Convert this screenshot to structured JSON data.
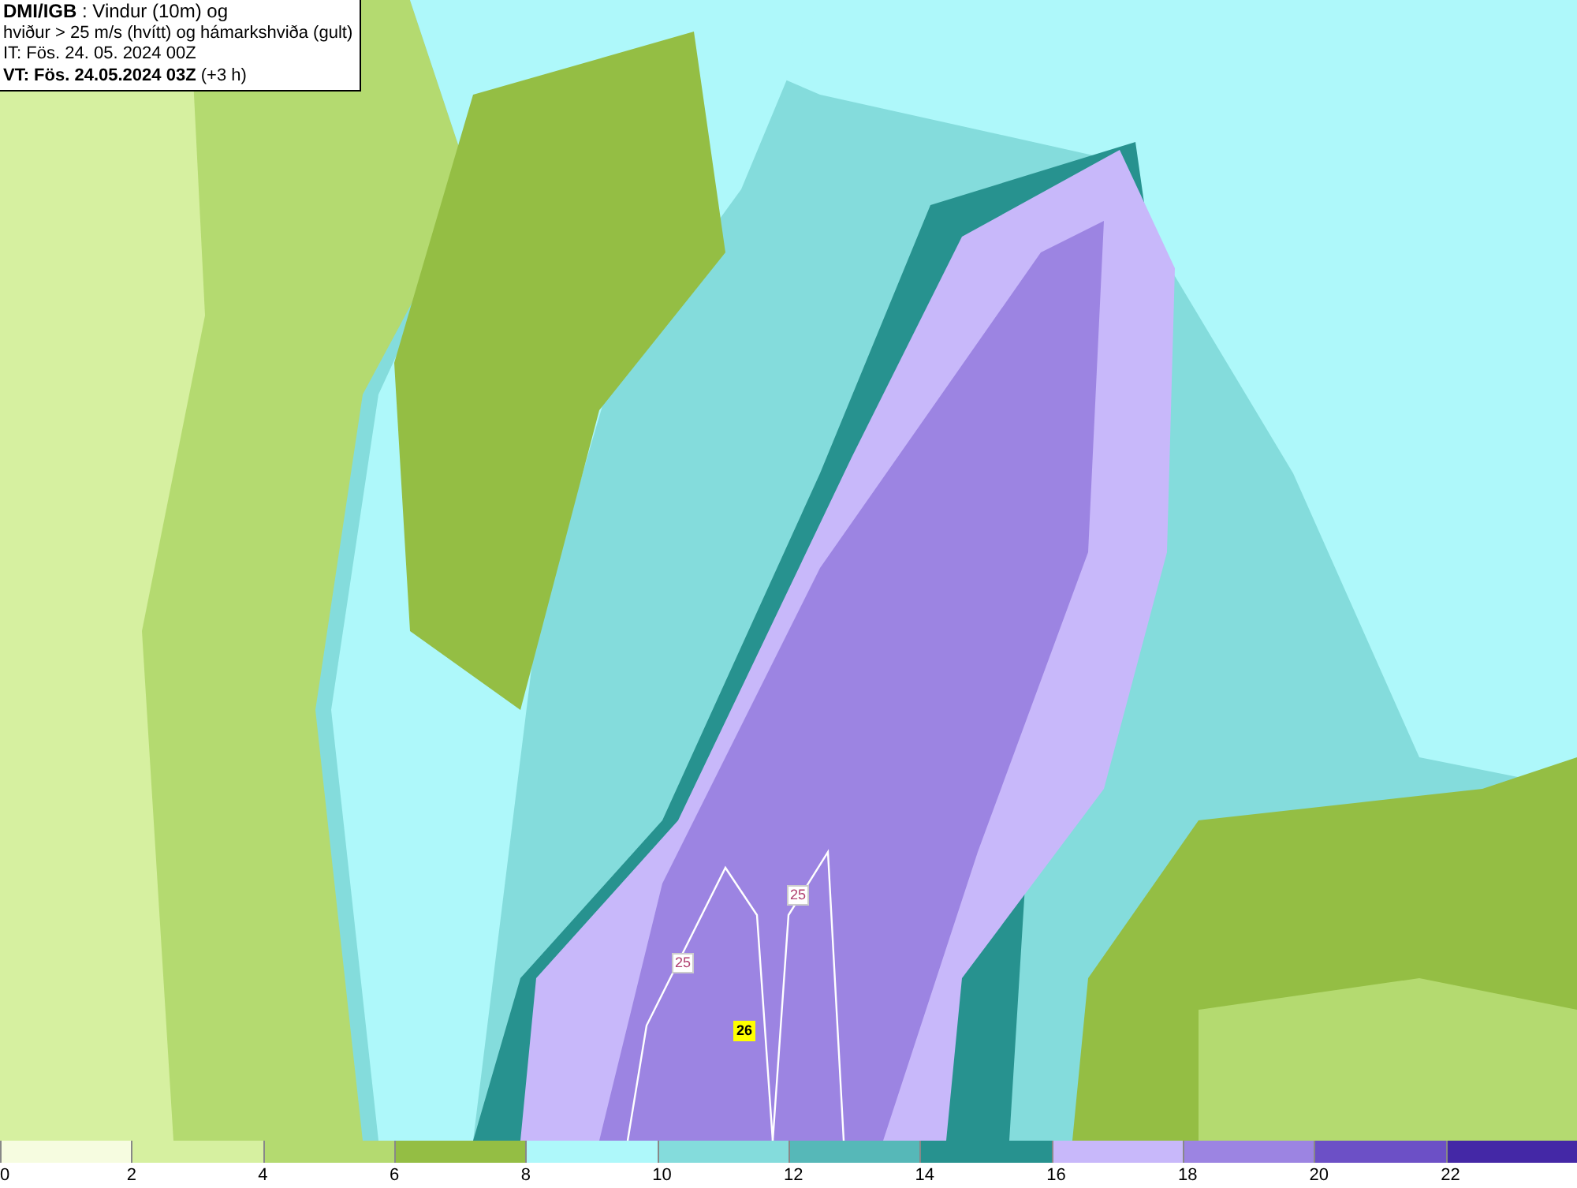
{
  "title_box": {
    "lines": [
      "**DMI/IGB** : Vindur (10m) og",
      "hviður > 25 m/s (hvítt) og hámarkshviða (gult)",
      "IT: Fös. 24. 05. 2024 00Z",
      "**VT: Fös. 24.05.2024 03Z** (+3 h)"
    ]
  },
  "contour_labels": [
    {
      "text": "25",
      "kind": "gust"
    },
    {
      "text": "25",
      "kind": "gust"
    },
    {
      "text": "26",
      "kind": "max"
    }
  ],
  "legend": [
    {
      "label": "0",
      "color": "#f6fce0"
    },
    {
      "label": "2",
      "color": "#d6f0a0"
    },
    {
      "label": "4",
      "color": "#b4da70"
    },
    {
      "label": "6",
      "color": "#94be44"
    },
    {
      "label": "8",
      "color": "#aef8fa"
    },
    {
      "label": "10",
      "color": "#84dcdc"
    },
    {
      "label": "12",
      "color": "#56b8b8"
    },
    {
      "label": "14",
      "color": "#27928f"
    },
    {
      "label": "16",
      "color": "#c8b8fa"
    },
    {
      "label": "18",
      "color": "#9c84e2"
    },
    {
      "label": "20",
      "color": "#6c50c6"
    },
    {
      "label": "22",
      "color": "#4428a6"
    }
  ]
}
